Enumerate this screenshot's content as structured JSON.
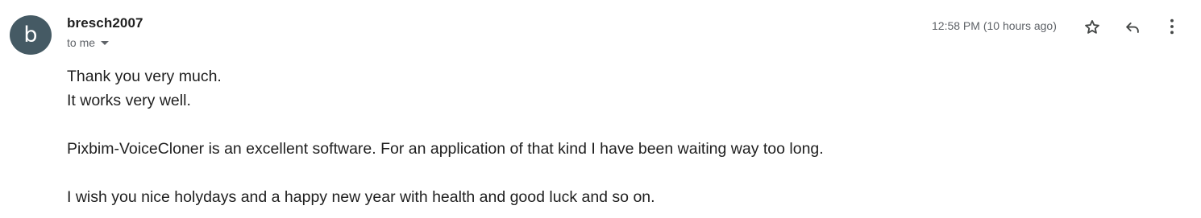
{
  "message": {
    "sender": {
      "avatar_letter": "b",
      "name": "bresch2007",
      "avatar_color": "#455a64"
    },
    "recipient_label": "to me",
    "timestamp": "12:58 PM (10 hours ago)",
    "actions": {
      "star_icon": "star-outline-icon",
      "reply_icon": "reply-icon",
      "more_icon": "more-vert-icon"
    },
    "body": {
      "line1": "Thank you very much.",
      "line2": "It works very well.",
      "line3": "Pixbim-VoiceCloner is an excellent software. For an application of that kind I have been waiting way too long.",
      "line4": "I wish you nice holydays and a happy new year with health and good luck and so on."
    }
  }
}
